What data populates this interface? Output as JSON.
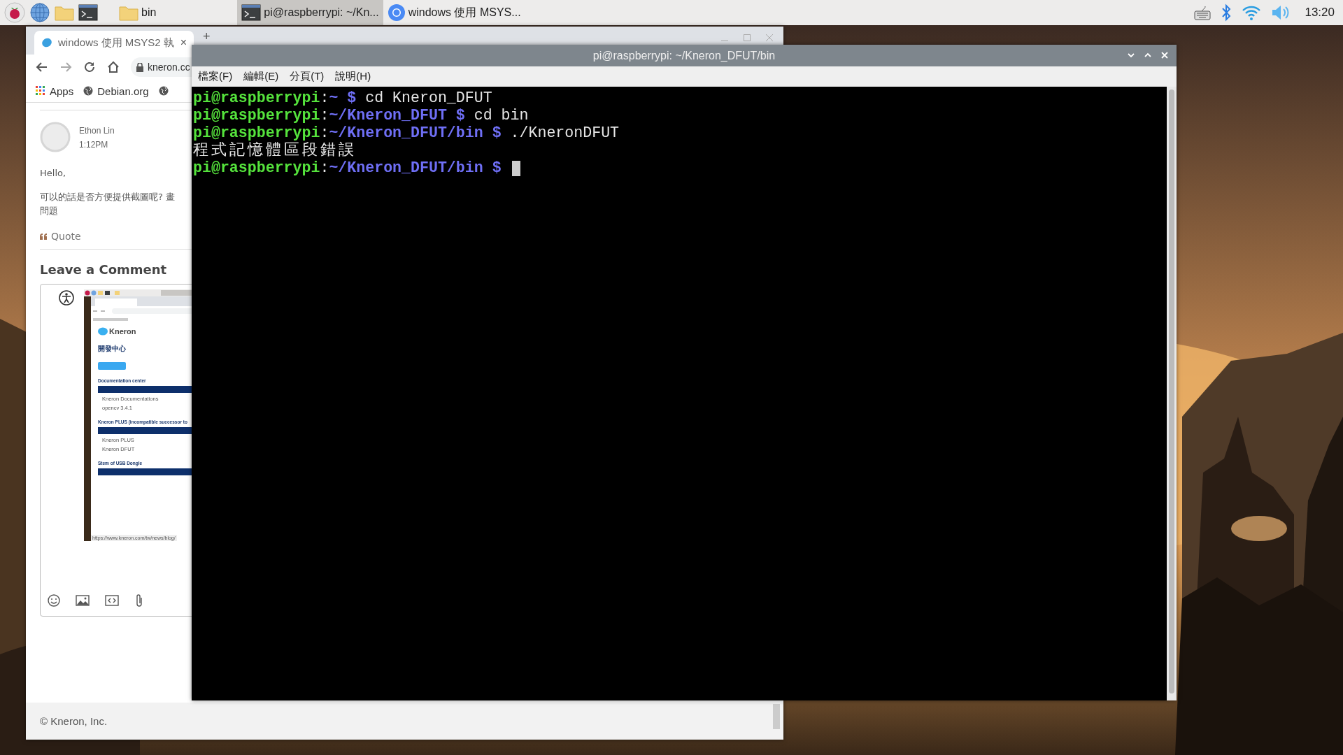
{
  "taskbar": {
    "tasks": [
      {
        "kind": "folder",
        "label": "bin",
        "selected": false
      },
      {
        "kind": "terminal",
        "label": "pi@raspberrypi: ~/Kn...",
        "selected": true
      },
      {
        "kind": "browser",
        "label": "windows 使用 MSYS...",
        "selected": false
      }
    ],
    "clock": "13:20"
  },
  "browser": {
    "tab": {
      "title": "windows 使用 MSYS2 執",
      "close": "×"
    },
    "new_tab": "+",
    "address": "kneron.cc",
    "bookmarks": [
      "Apps",
      "Debian.org"
    ],
    "comment": {
      "author": "Ethon Lin",
      "time": "1:12PM",
      "lines": [
        "Hello,",
        "可以的話是否方便提供截圖呢? 畫",
        "問題"
      ],
      "quote": "Quote"
    },
    "heading": "Leave a Comment",
    "attachment": {
      "kind": "screenshot",
      "logo": "Kneron",
      "heading": "開發中心",
      "sections": [
        {
          "title": "Documentation center",
          "rows": [
            "Kneron Documentations",
            "opencv 3.4.1"
          ]
        },
        {
          "title": "Kneron PLUS (incompatible successor to",
          "rows": [
            "Kneron PLUS",
            "Kneron DFUT"
          ]
        },
        {
          "title": "Stem of USB Dongle"
        }
      ],
      "status_url": "https://www.kneron.com/tw/news/blog/"
    },
    "footer": "© Kneron, Inc."
  },
  "terminal": {
    "title": "pi@raspberrypi: ~/Kneron_DFUT/bin",
    "menu": [
      "檔案(F)",
      "編輯(E)",
      "分頁(T)",
      "說明(H)"
    ],
    "lines": [
      {
        "kind": "prompt",
        "user": "pi@raspberrypi",
        "sep": ":",
        "path": "~",
        "sign": "$",
        "command": "cd Kneron_DFUT"
      },
      {
        "kind": "prompt",
        "user": "pi@raspberrypi",
        "sep": ":",
        "path": "~/Kneron_DFUT",
        "sign": "$",
        "command": "cd bin"
      },
      {
        "kind": "prompt",
        "user": "pi@raspberrypi",
        "sep": ":",
        "path": "~/Kneron_DFUT/bin",
        "sign": "$",
        "command": "./KneronDFUT"
      },
      {
        "kind": "output",
        "text": "程式記憶體區段錯誤"
      },
      {
        "kind": "prompt",
        "user": "pi@raspberrypi",
        "sep": ":",
        "path": "~/Kneron_DFUT/bin",
        "sign": "$",
        "cursor": true
      }
    ]
  }
}
